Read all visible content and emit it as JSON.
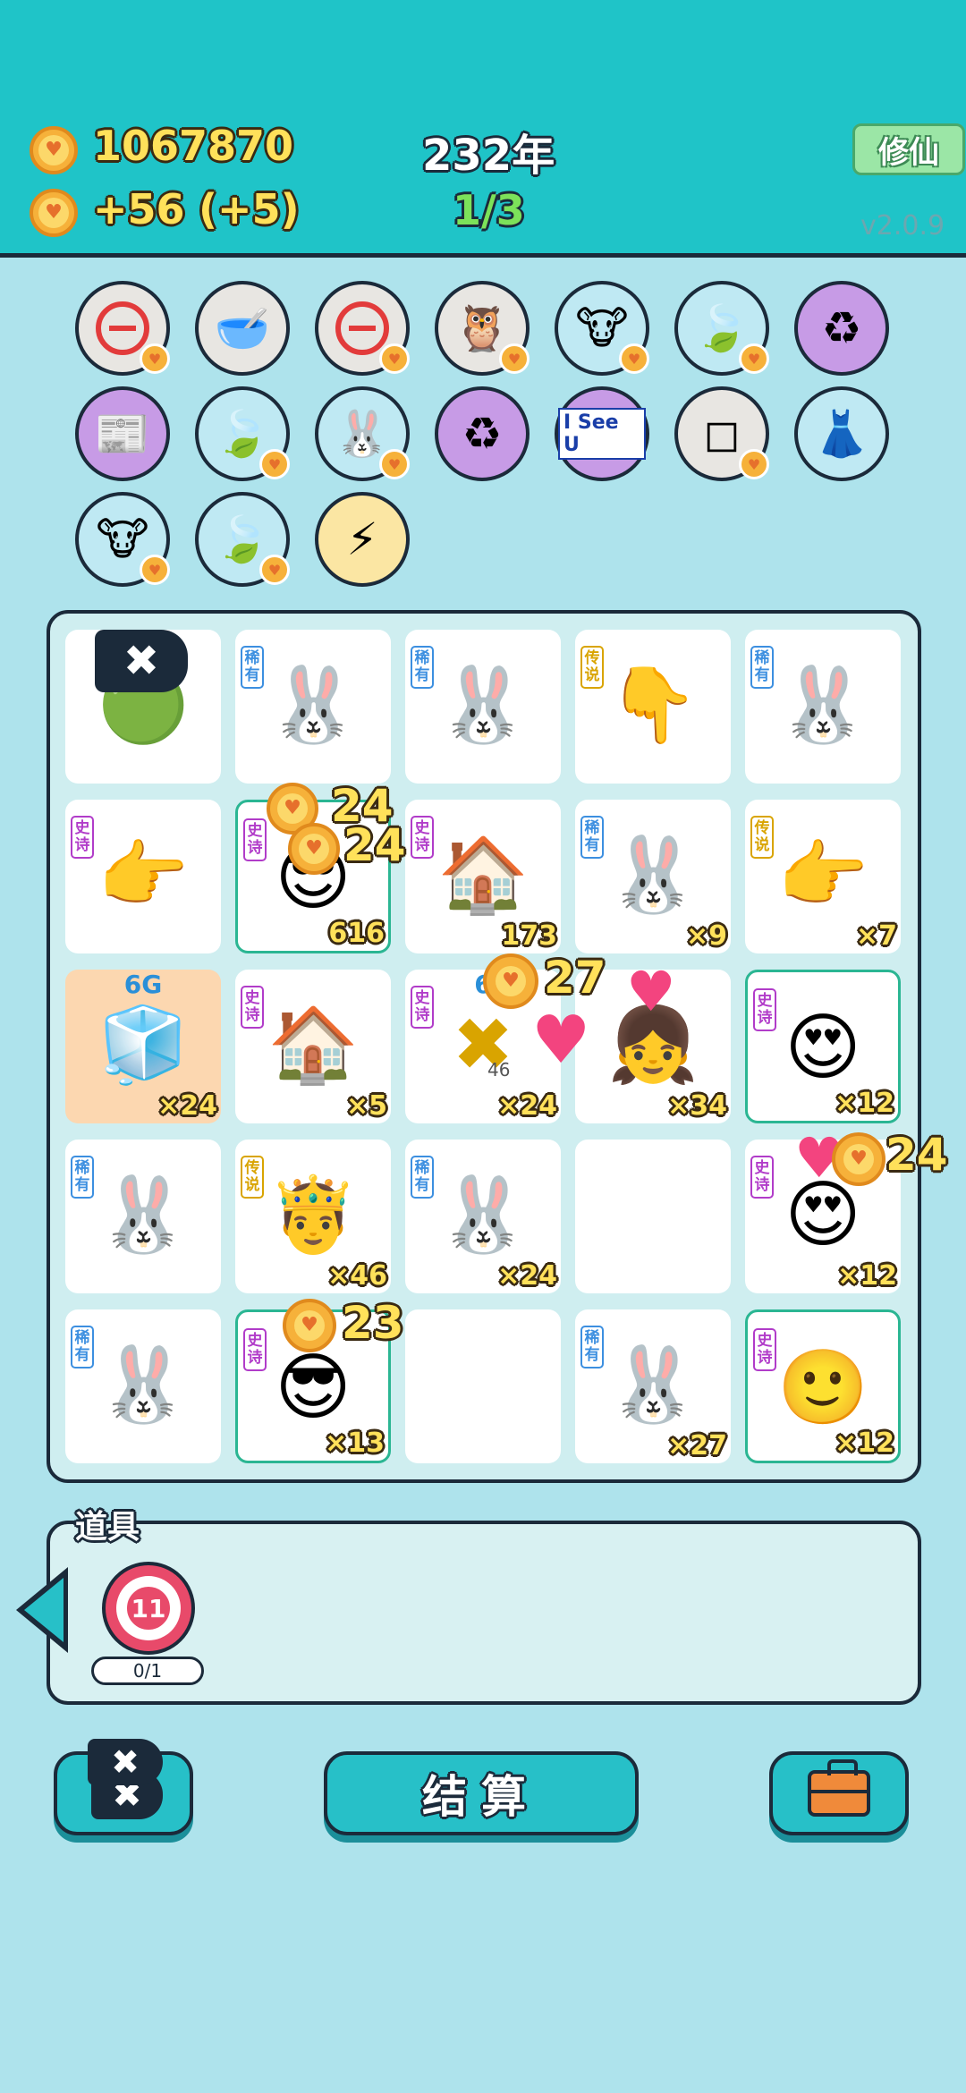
{
  "header": {
    "gold": "1067870",
    "income": "+56",
    "income_bonus": "(+5)",
    "year": "232年",
    "progress": "1/3",
    "mode_button": "修仙",
    "version": "v2.0.9"
  },
  "relics": [
    {
      "icon": "no-entry",
      "symbol": "⊖",
      "bg": "#e8e6e2"
    },
    {
      "icon": "dog-bowl",
      "symbol": "🥣",
      "bg": "#e8e6e2"
    },
    {
      "icon": "no-entry",
      "symbol": "⊖",
      "bg": "#e8e6e2"
    },
    {
      "icon": "owl-glasses",
      "symbol": "🦉",
      "bg": "#e8e6e2"
    },
    {
      "icon": "cow-pair",
      "symbol": "🐮",
      "bg": "#bfe9f3"
    },
    {
      "icon": "leaf",
      "symbol": "🍃",
      "bg": "#bfe9f3"
    },
    {
      "icon": "recycle",
      "symbol": "♻",
      "bg": "#c79be6"
    },
    {
      "icon": "time-magazine",
      "symbol": "📰",
      "bg": "#c79be6"
    },
    {
      "icon": "leaf",
      "symbol": "🍃",
      "bg": "#bfe9f3"
    },
    {
      "icon": "rabbit",
      "symbol": "🐰",
      "bg": "#bfe9f3"
    },
    {
      "icon": "recycle",
      "symbol": "♻",
      "bg": "#c79be6"
    },
    {
      "icon": "i-see-u-card",
      "symbol": "I See U",
      "bg": "#c79be6"
    },
    {
      "icon": "sugar-cubes",
      "symbol": "◻",
      "bg": "#e8e6e2"
    },
    {
      "icon": "skirt",
      "symbol": "👗",
      "bg": "#bfe9f3"
    },
    {
      "icon": "cow-pair",
      "symbol": "🐮",
      "bg": "#bfe9f3"
    },
    {
      "icon": "leaf",
      "symbol": "🍃",
      "bg": "#bfe9f3"
    },
    {
      "icon": "lightning",
      "symbol": "⚡",
      "bg": "#fbe6a3"
    }
  ],
  "tags": {
    "rare": "稀有",
    "epic": "史诗",
    "legend": "传说"
  },
  "board": [
    {
      "icon": "green-potion",
      "symbol": "🟢",
      "tag": "",
      "count": "",
      "style": "plain"
    },
    {
      "icon": "rabbit",
      "symbol": "🐰",
      "tag": "rare",
      "count": "",
      "style": "plain"
    },
    {
      "icon": "rabbit",
      "symbol": "🐰",
      "tag": "rare",
      "count": "",
      "style": "plain"
    },
    {
      "icon": "pointing-hand-yellow",
      "symbol": "👇",
      "tag": "legend",
      "count": "",
      "style": "plain"
    },
    {
      "icon": "rabbit",
      "symbol": "🐰",
      "tag": "rare",
      "count": "",
      "style": "plain"
    },
    {
      "icon": "pointing-hand-gray",
      "symbol": "👉",
      "tag": "epic",
      "count": "",
      "style": "plain"
    },
    {
      "icon": "man-sunglasses",
      "symbol": "😎",
      "tag": "epic",
      "count": "616",
      "style": "hl"
    },
    {
      "icon": "rabbit-house",
      "symbol": "🏠",
      "tag": "epic",
      "count": "173",
      "style": "plain"
    },
    {
      "icon": "rabbit",
      "symbol": "🐰",
      "tag": "rare",
      "count": "×9",
      "style": "plain"
    },
    {
      "icon": "pointing-hand-yellow",
      "symbol": "👉",
      "tag": "legend",
      "count": "×7",
      "style": "plain"
    },
    {
      "icon": "fridge",
      "symbol": "🧊",
      "tag": "",
      "count": "×24",
      "style": "orange",
      "label": "6G"
    },
    {
      "icon": "rabbit-house",
      "symbol": "🏠",
      "tag": "epic",
      "count": "×5",
      "style": "plain"
    },
    {
      "icon": "golden-mask",
      "symbol": "✖",
      "tag": "epic",
      "count": "×24",
      "style": "plain",
      "label": "6",
      "mini": "46"
    },
    {
      "icon": "girl-braids",
      "symbol": "👧",
      "tag": "",
      "count": "×34",
      "style": "plain"
    },
    {
      "icon": "heart-eyes-face",
      "symbol": "😍",
      "tag": "epic",
      "count": "×12",
      "style": "hl"
    },
    {
      "icon": "rabbit",
      "symbol": "🐰",
      "tag": "rare",
      "count": "",
      "style": "plain"
    },
    {
      "icon": "red-king",
      "symbol": "🤴",
      "tag": "legend",
      "count": "×46",
      "style": "plain"
    },
    {
      "icon": "rabbit",
      "symbol": "🐰",
      "tag": "rare",
      "count": "×24",
      "style": "plain"
    },
    {
      "icon": "empty",
      "symbol": "",
      "tag": "",
      "count": "",
      "style": "plain"
    },
    {
      "icon": "heart-eyes-elf",
      "symbol": "😍",
      "tag": "epic",
      "count": "×12",
      "style": "plain"
    },
    {
      "icon": "rabbit",
      "symbol": "🐰",
      "tag": "rare",
      "count": "",
      "style": "plain"
    },
    {
      "icon": "man-sunglasses",
      "symbol": "😎",
      "tag": "epic",
      "count": "×13",
      "style": "hl"
    },
    {
      "icon": "empty",
      "symbol": "",
      "tag": "",
      "count": "",
      "style": "plain"
    },
    {
      "icon": "rabbit",
      "symbol": "🐰",
      "tag": "rare",
      "count": "×27",
      "style": "plain"
    },
    {
      "icon": "red-cap-boy",
      "symbol": "🙂",
      "tag": "epic",
      "count": "×12",
      "style": "hl"
    }
  ],
  "popups": {
    "a": "24",
    "b": "24",
    "c": "27",
    "d": "24",
    "e": "23"
  },
  "items": {
    "title": "道具",
    "target_value": "11",
    "target_usage": "0/1"
  },
  "actions": {
    "settle": "结算"
  }
}
